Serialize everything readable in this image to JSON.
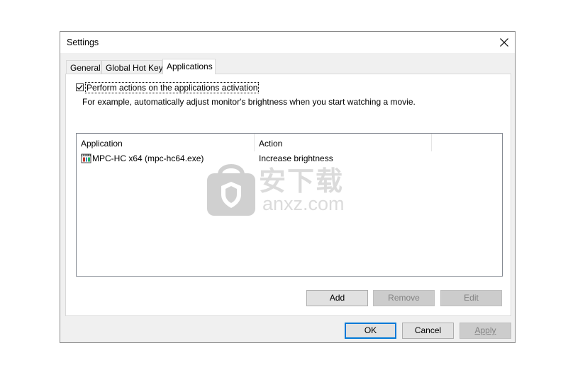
{
  "window": {
    "title": "Settings"
  },
  "tabs": [
    {
      "label": "General",
      "active": false
    },
    {
      "label": "Global Hot Keys",
      "active": false
    },
    {
      "label": "Applications",
      "active": true
    }
  ],
  "applications": {
    "checkbox_label": "Perform actions on the applications activation",
    "checkbox_checked": true,
    "description": "For example, automatically adjust monitor's brightness when you start watching a movie.",
    "list": {
      "columns": [
        "Application",
        "Action",
        ""
      ],
      "rows": [
        {
          "application": "MPC-HC x64 (mpc-hc64.exe)",
          "action": "Increase brightness",
          "icon": "mpc-hc-icon"
        }
      ]
    },
    "buttons": {
      "add": "Add",
      "remove": "Remove",
      "edit": "Edit"
    }
  },
  "footer": {
    "ok": "OK",
    "cancel": "Cancel",
    "apply": "Apply"
  },
  "watermark": {
    "cn": "安下载",
    "en": "anxz.com",
    "icon": "shield-bag-icon"
  },
  "colors": {
    "accent": "#0078d7",
    "dialog_bg": "#f0f0f0",
    "disabled_text": "#838383"
  }
}
